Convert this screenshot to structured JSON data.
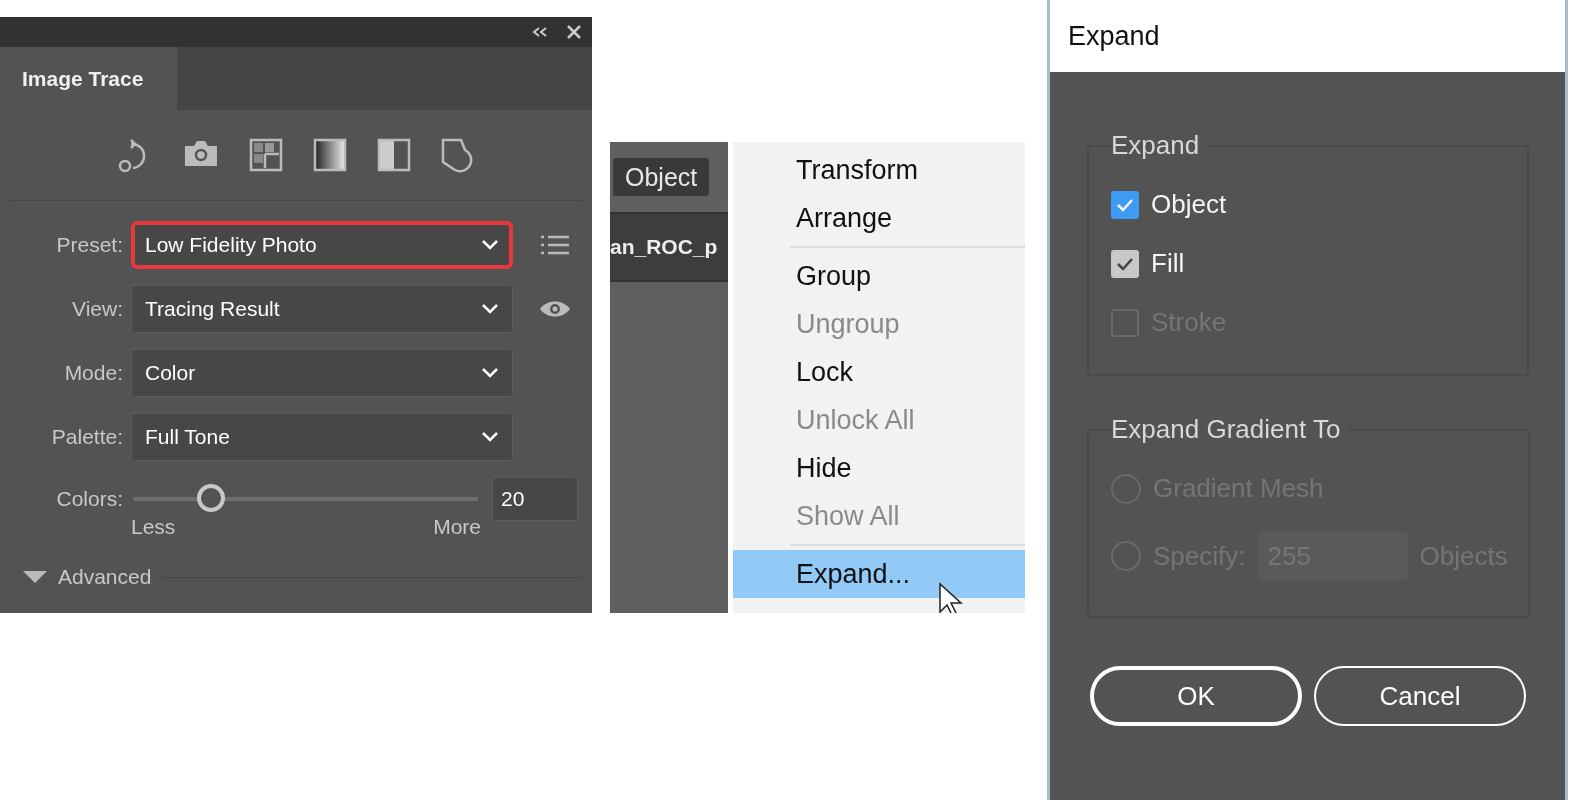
{
  "image_trace": {
    "tab": {
      "label": "Image Trace",
      "selected": true
    },
    "fields": [
      {
        "label": "Preset:",
        "value": "Low Fidelity Photo",
        "highlighted": true
      },
      {
        "label": "View:",
        "value": "Tracing Result",
        "highlighted": false
      },
      {
        "label": "Mode:",
        "value": "Color",
        "highlighted": false
      },
      {
        "label": "Palette:",
        "value": "Full Tone",
        "highlighted": false
      }
    ],
    "colors": {
      "label": "Colors:",
      "level": 0.22,
      "value": "20",
      "min_label": "Less",
      "max_label": "More"
    },
    "advanced": {
      "label": "Advanced",
      "expanded": true
    }
  },
  "menu": {
    "menu_title": {
      "label": "Object",
      "selected": true
    },
    "document_tab": "an_ROC_p",
    "groups": [
      {
        "items": [
          {
            "label": "Transform",
            "disabled": false,
            "selected": false
          },
          {
            "label": "Arrange",
            "disabled": false,
            "selected": false
          }
        ]
      },
      {
        "items": [
          {
            "label": "Group",
            "disabled": false,
            "selected": false
          },
          {
            "label": "Ungroup",
            "disabled": true,
            "selected": false
          },
          {
            "label": "Lock",
            "disabled": false,
            "selected": false
          },
          {
            "label": "Unlock All",
            "disabled": true,
            "selected": false
          },
          {
            "label": "Hide",
            "disabled": false,
            "selected": false
          },
          {
            "label": "Show All",
            "disabled": true,
            "selected": false
          }
        ]
      },
      {
        "items": [
          {
            "label": "Expand...",
            "disabled": false,
            "selected": true
          }
        ]
      }
    ]
  },
  "dialog": {
    "title": "Expand",
    "expand_group": {
      "label": "Expand",
      "options": [
        {
          "label": "Object",
          "checked": true,
          "color": "#3d9bf4",
          "disabled": false
        },
        {
          "label": "Fill",
          "checked": true,
          "color": "#c8c8c8",
          "disabled": false
        },
        {
          "label": "Stroke",
          "checked": false,
          "disabled": true
        }
      ]
    },
    "gradient_group": {
      "label": "Expand Gradient To",
      "disabled": true,
      "options": [
        {
          "label": "Gradient Mesh",
          "selected": false
        },
        {
          "label": "Specify:",
          "selected": false,
          "value": "255",
          "unit": "Objects"
        }
      ]
    },
    "buttons": [
      {
        "label": "OK",
        "default": true
      },
      {
        "label": "Cancel",
        "default": false
      }
    ]
  }
}
